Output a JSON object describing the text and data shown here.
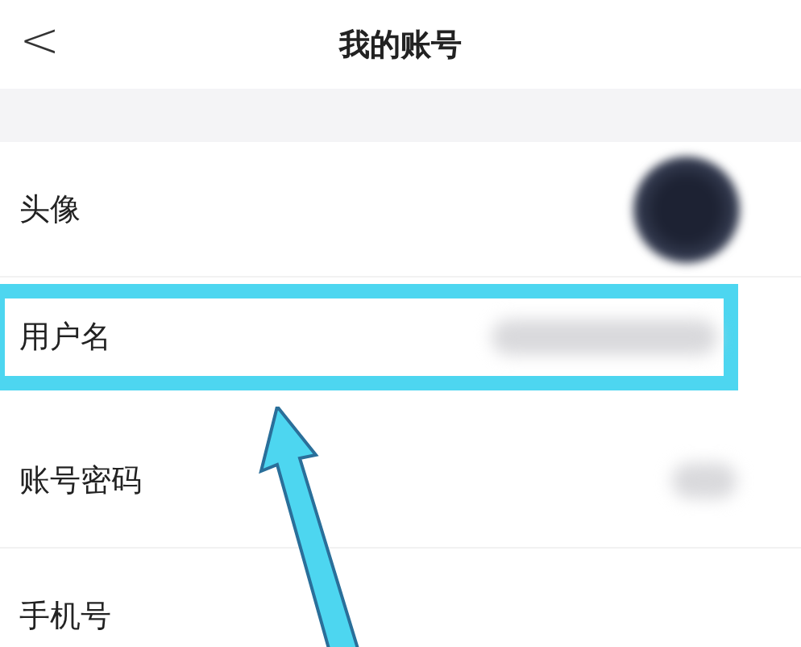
{
  "header": {
    "back": "<",
    "title": "我的账号"
  },
  "rows": [
    {
      "label": "头像",
      "kind": "avatar",
      "highlighted": false
    },
    {
      "label": "用户名",
      "kind": "value",
      "highlighted": true
    },
    {
      "label": "账号密码",
      "kind": "short",
      "highlighted": false
    },
    {
      "label": "手机号",
      "kind": "none",
      "highlighted": false
    }
  ],
  "annotation": {
    "arrow": true
  }
}
